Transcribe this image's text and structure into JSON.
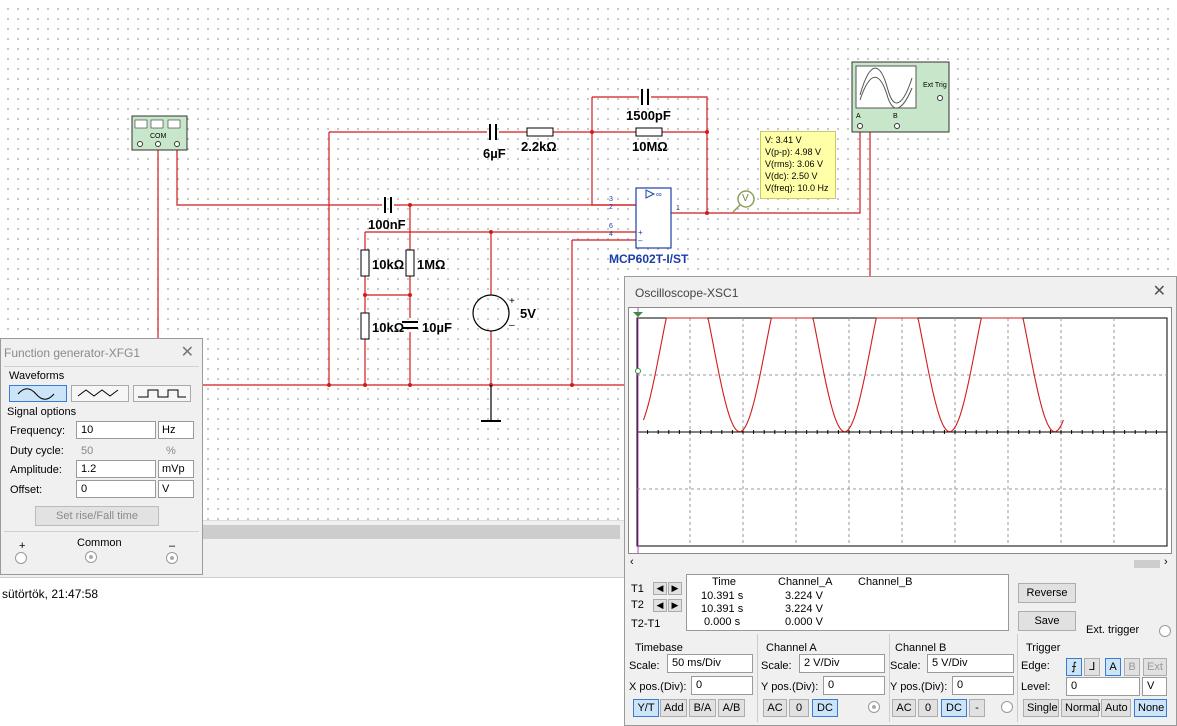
{
  "schematic": {
    "components": {
      "c_6uf": "6µF",
      "r_2k2": "2.2kΩ",
      "c_1500pf": "1500pF",
      "r_10m": "10MΩ",
      "c_100nf": "100nF",
      "r_10k_a": "10kΩ",
      "r_1m": "1MΩ",
      "r_10k_b": "10kΩ",
      "c_10uf": "10µF",
      "v_5v": "5V",
      "opamp": "MCP602T-I/ST",
      "fg_com": "COM",
      "scope_ext": "Ext Trig",
      "scope_a": "A",
      "scope_b": "B",
      "probe_letter": "V"
    },
    "pins": {
      "p3": "3",
      "p2": "2",
      "p1": "1",
      "p6": "6",
      "p4": "4",
      "p5": "5"
    },
    "probe": {
      "v": "V: 3.41 V",
      "vpp": "V(p-p): 4.98 V",
      "vrms": "V(rms): 3.06 V",
      "vdc": "V(dc): 2.50 V",
      "vfreq": "V(freq): 10.0 Hz"
    },
    "colors": {
      "wire": "#d11b1b",
      "opamp_blue": "#1b3fa8"
    }
  },
  "log": {
    "line": "sütörtök, 21:47:58"
  },
  "function_generator": {
    "title": "Function generator-XFG1",
    "waveforms_label": "Waveforms",
    "waveforms": [
      "sine-wave-icon",
      "triangle-wave-icon",
      "square-wave-icon"
    ],
    "selected_waveform": "sine",
    "signal_options_label": "Signal options",
    "fields": [
      {
        "label": "Frequency:",
        "value": "10",
        "unit": "Hz",
        "disabled": false
      },
      {
        "label": "Duty cycle:",
        "value": "50",
        "unit": "%",
        "disabled": true
      },
      {
        "label": "Amplitude:",
        "value": "1.2",
        "unit": "mVp",
        "disabled": false
      },
      {
        "label": "Offset:",
        "value": "0",
        "unit": "V",
        "disabled": false
      }
    ],
    "rise_fall_button": "Set rise/Fall time",
    "terminals": {
      "plus": "+",
      "common": "Common",
      "minus": "–"
    }
  },
  "oscilloscope": {
    "title": "Oscilloscope-XSC1",
    "trace": {
      "color": "#d11b1b",
      "cycles_visible": 4,
      "offset_div": 2.5,
      "amplitude_div": 2.49,
      "x_start_fraction": 0.012
    },
    "cursors": {
      "header": [
        "Time",
        "Channel_A",
        "Channel_B"
      ],
      "rows": [
        {
          "name": "T1",
          "time": "10.391 s",
          "a": "3.224 V",
          "b": ""
        },
        {
          "name": "T2",
          "time": "10.391 s",
          "a": "3.224 V",
          "b": ""
        },
        {
          "name": "T2-T1",
          "time": "0.000 s",
          "a": "0.000 V",
          "b": ""
        }
      ]
    },
    "reverse_button": "Reverse",
    "save_button": "Save",
    "ext_trigger_label": "Ext. trigger",
    "timebase": {
      "label": "Timebase",
      "scale_label": "Scale:",
      "scale": "50 ms/Div",
      "xpos_label": "X pos.(Div):",
      "xpos": "0",
      "modes": [
        "Y/T",
        "Add",
        "B/A",
        "A/B"
      ],
      "active_mode": "Y/T"
    },
    "channel_a": {
      "label": "Channel A",
      "scale_label": "Scale:",
      "scale": "2  V/Div",
      "ypos_label": "Y pos.(Div):",
      "ypos": "0",
      "coupling": [
        "AC",
        "0",
        "DC"
      ],
      "active": "DC"
    },
    "channel_b": {
      "label": "Channel B",
      "scale_label": "Scale:",
      "scale": "5  V/Div",
      "ypos_label": "Y pos.(Div):",
      "ypos": "0",
      "coupling": [
        "AC",
        "0",
        "DC",
        "-"
      ],
      "active": "DC"
    },
    "trigger": {
      "label": "Trigger",
      "edge_label": "Edge:",
      "level_label": "Level:",
      "level": "0",
      "level_unit": "V",
      "sources": [
        "A",
        "B",
        "Ext"
      ],
      "active_source": "A",
      "modes": [
        "Single",
        "Normal",
        "Auto",
        "None"
      ],
      "active_mode": "None"
    }
  }
}
